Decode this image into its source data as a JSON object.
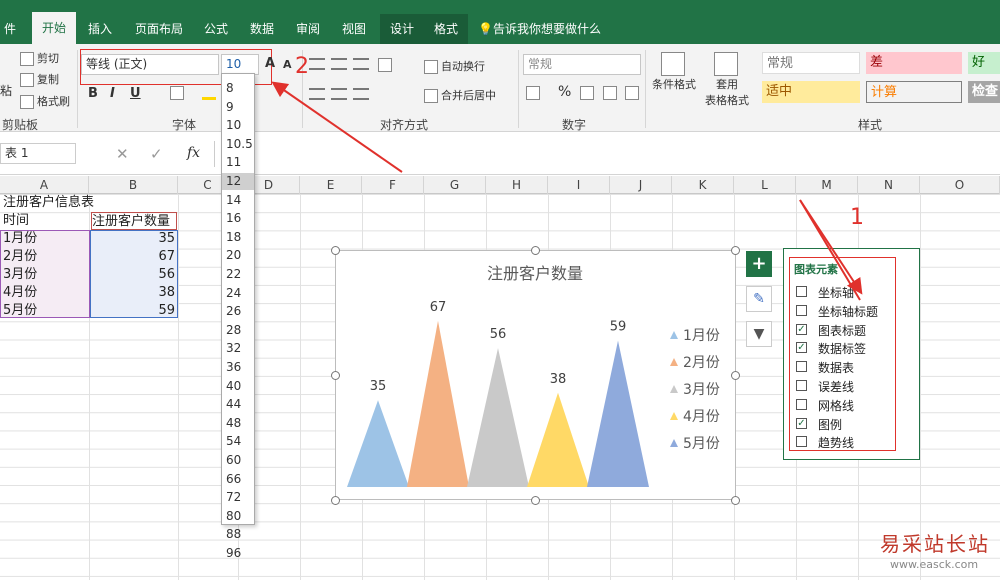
{
  "tabs": [
    "件",
    "开始",
    "插入",
    "页面布局",
    "公式",
    "数据",
    "审阅",
    "视图",
    "设计",
    "格式"
  ],
  "tell_me": "告诉我你想要做什么",
  "clipboard": {
    "cut": "剪切",
    "copy": "复制",
    "painter": "格式刷",
    "paste_partial": "粘",
    "group": "剪贴板"
  },
  "font": {
    "name": "等线 (正文)",
    "size": "10",
    "group": "字体",
    "bold": "B",
    "italic": "I",
    "underline": "U",
    "grow": "A",
    "shrink": "A"
  },
  "alignment": {
    "wrap": "自动换行",
    "merge": "合并后居中",
    "group": "对齐方式"
  },
  "number": {
    "format": "常规",
    "percent": "%",
    "group": "数字"
  },
  "styles": {
    "cond": "条件格式",
    "table": "套用",
    "table2": "表格格式",
    "group": "样式",
    "cells": [
      "常规",
      "差",
      "好",
      "适中",
      "计算",
      "检查"
    ]
  },
  "formula": {
    "namebox": "表 1",
    "fx": "fx"
  },
  "columns": [
    "A",
    "B",
    "C",
    "D",
    "E",
    "F",
    "G",
    "H",
    "I",
    "J",
    "K",
    "L",
    "M",
    "N",
    "O"
  ],
  "sheet": {
    "title": "注册客户信息表",
    "h1": "时间",
    "h2": "注册客户数量",
    "rows": [
      {
        "m": "1月份",
        "v": "35"
      },
      {
        "m": "2月份",
        "v": "67"
      },
      {
        "m": "3月份",
        "v": "56"
      },
      {
        "m": "4月份",
        "v": "38"
      },
      {
        "m": "5月份",
        "v": "59"
      }
    ]
  },
  "font_sizes": [
    "8",
    "9",
    "10",
    "10.5",
    "11",
    "12",
    "14",
    "16",
    "18",
    "20",
    "22",
    "24",
    "26",
    "28",
    "32",
    "36",
    "40",
    "44",
    "48",
    "54",
    "60",
    "66",
    "72",
    "80",
    "88",
    "96"
  ],
  "font_size_selected": "12",
  "chart_data": {
    "type": "bar",
    "title": "注册客户数量",
    "categories": [
      "1月份",
      "2月份",
      "3月份",
      "4月份",
      "5月份"
    ],
    "values": [
      35,
      67,
      56,
      38,
      59
    ],
    "colors": [
      "#9dc3e6",
      "#f4b183",
      "#c9c9c9",
      "#ffd966",
      "#8faadc"
    ],
    "legend": "right",
    "ylim": [
      0,
      75
    ]
  },
  "chart_elements": {
    "title": "图表元素",
    "items": [
      {
        "label": "坐标轴",
        "checked": false
      },
      {
        "label": "坐标轴标题",
        "checked": false
      },
      {
        "label": "图表标题",
        "checked": true
      },
      {
        "label": "数据标签",
        "checked": true
      },
      {
        "label": "数据表",
        "checked": false
      },
      {
        "label": "误差线",
        "checked": false
      },
      {
        "label": "网格线",
        "checked": false
      },
      {
        "label": "图例",
        "checked": true
      },
      {
        "label": "趋势线",
        "checked": false
      }
    ]
  },
  "annotations": {
    "one": "1",
    "two": "2"
  },
  "watermark": {
    "cn": "易采站长站",
    "url": "www.easck.com"
  }
}
